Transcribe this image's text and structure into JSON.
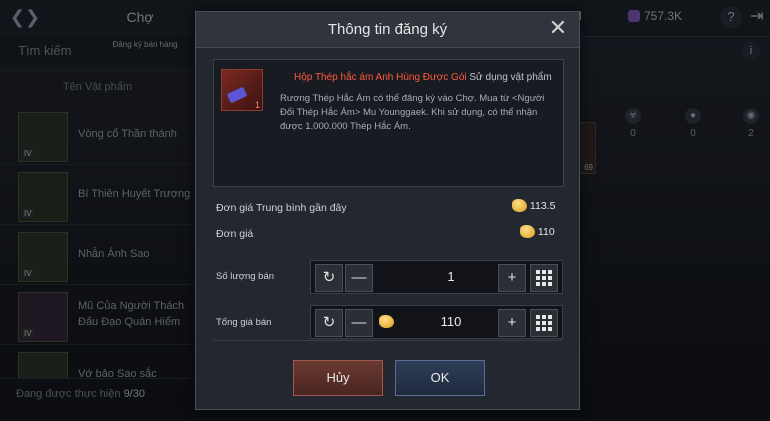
{
  "topbar": {
    "tab": "Chợ",
    "currency_value": "757.3K",
    "partial_value": "M",
    "help_label": "?"
  },
  "left": {
    "subtab_search": "Tìm kiếm",
    "subtab_register": "Đăng ký bán hàng",
    "column_header": "Tên Vật phẩm",
    "items": [
      {
        "name": "Vòng cổ Thần thánh",
        "badge": "IV"
      },
      {
        "name": "Bí Thiên Huyết Trượng",
        "badge": "IV"
      },
      {
        "name": "Nhẫn Ánh Sao",
        "badge": "IV"
      },
      {
        "name": "Mũ Của Người Thách Đấu Đạo Quán Hiểm",
        "badge": "IV"
      },
      {
        "name": "Vớ bảo Sao sắc",
        "badge": ""
      }
    ],
    "progress_text": "Đang được thực hiện",
    "progress_count": "9/30"
  },
  "right": {
    "stats": [
      "0",
      "0",
      "2"
    ],
    "item_count": "69"
  },
  "modal": {
    "title": "Thông tin đăng ký",
    "item_name": "Hộp Thép hắc ám Anh Hùng Được Gói",
    "item_type": "Sử dụng vật phẩm",
    "item_qty": "1",
    "description": "Rương Thép Hắc Ám có thể đăng ký vào Chợ. Mua từ <Người Đổi Thép Hắc Ám> Mu Younggaek. Khi sử dụng, có thể nhận được 1.000.000 Thép Hắc Ám.",
    "avg_price_label": "Đơn giá Trung bình gần đây",
    "avg_price_value": "113.5",
    "unit_price_label": "Đơn giá",
    "unit_price_value": "110",
    "qty_label": "Số lượng bán",
    "qty_value": "1",
    "total_label": "Tổng giá bán",
    "total_value": "110",
    "cancel_label": "Hủy",
    "ok_label": "OK"
  }
}
